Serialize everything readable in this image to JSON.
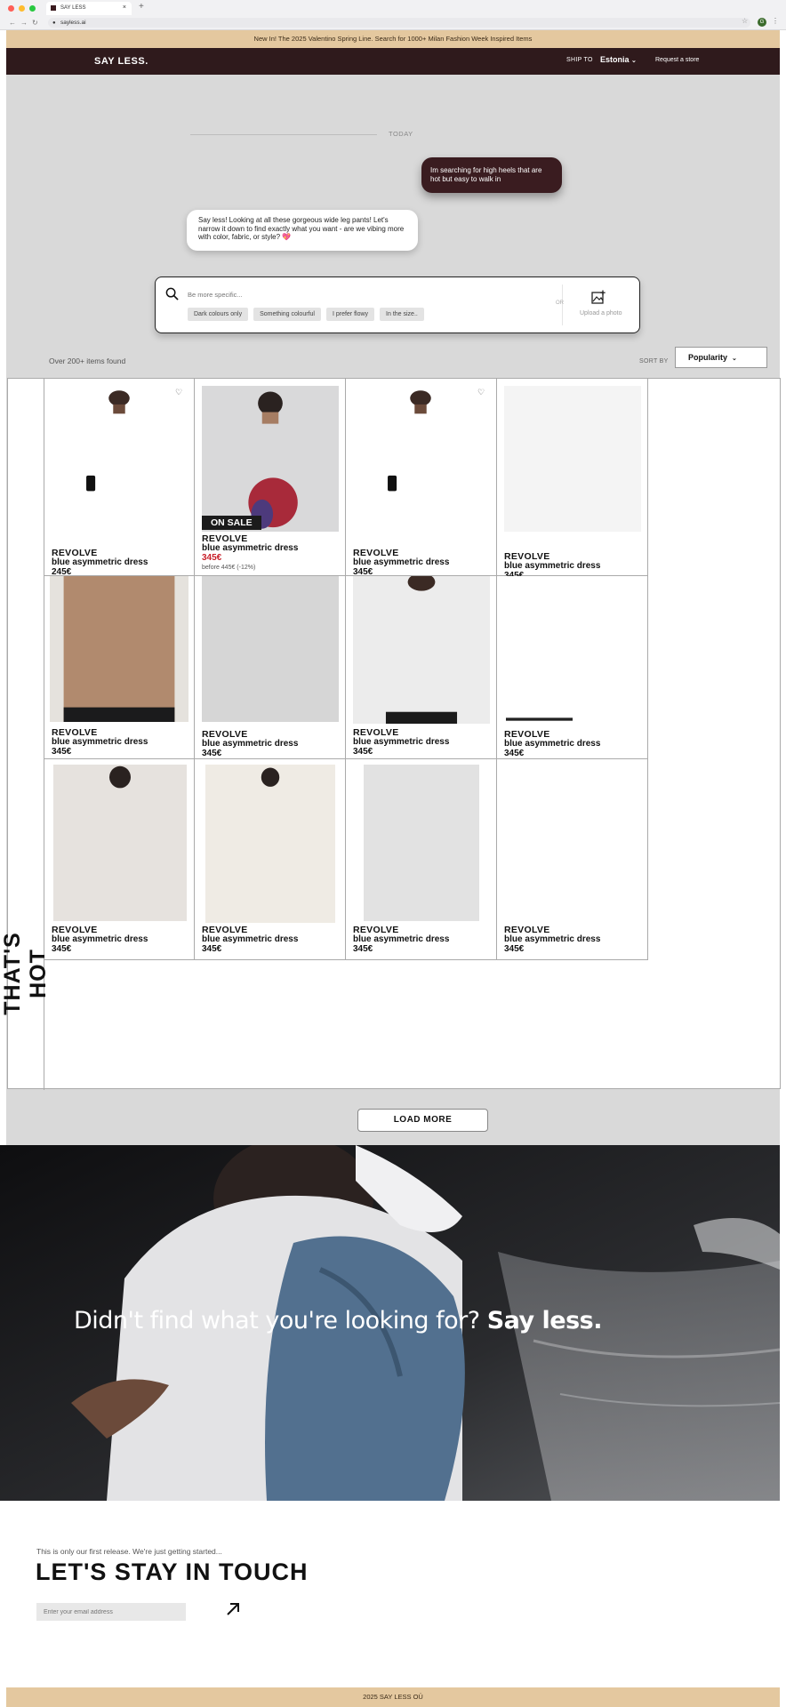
{
  "browser": {
    "tab_title": "SAY LESS",
    "url": "sayless.ai"
  },
  "promo_text": "New In! The 2025 Valentino Spring Line. Search for 1000+ Milan Fashion Week Inspired Items",
  "nav": {
    "logo": "SAY LESS.",
    "ship_to_label": "SHIP TO",
    "country": "Estonia",
    "request_store": "Request a store"
  },
  "chat": {
    "date_label": "TODAY",
    "user_message": "Im searching for high heels that are hot but easy to walk in",
    "bot_message": "Say less! Looking at all these gorgeous wide leg pants! Let's narrow it down to find exactly what you want - are we vibing more with color, fabric, or style? 💖"
  },
  "search": {
    "placeholder": "Be more specific...",
    "chips": [
      "Dark colours only",
      "Something colourful",
      "I prefer flowy",
      "In the size.."
    ],
    "or_label": "OR",
    "upload_label": "Upload a photo"
  },
  "results": {
    "count_text": "Over 200+ items found",
    "sort_label": "SORT BY",
    "sort_value": "Popularity"
  },
  "side_label": "THAT'S HOT",
  "products": [
    {
      "brand": "REVOLVE",
      "name": "blue asymmetric dress",
      "price": "245€",
      "sale": false,
      "was": "",
      "img": "navy-dress"
    },
    {
      "brand": "REVOLVE",
      "name": "blue asymmetric dress",
      "price": "345€",
      "sale": true,
      "was": "before 445€ (-12%)",
      "img": "strapless-floral",
      "badge": "ON SALE"
    },
    {
      "brand": "REVOLVE",
      "name": "blue asymmetric dress",
      "price": "345€",
      "sale": false,
      "was": "",
      "img": "navy-dress"
    },
    {
      "brand": "REVOLVE",
      "name": "blue asymmetric dress",
      "price": "345€",
      "sale": false,
      "was": "",
      "img": "cream-top"
    },
    {
      "brand": "REVOLVE",
      "name": "blue asymmetric dress",
      "price": "345€",
      "sale": false,
      "was": "",
      "img": "black-bra"
    },
    {
      "brand": "REVOLVE",
      "name": "blue asymmetric dress",
      "price": "345€",
      "sale": false,
      "was": "",
      "img": "bikini"
    },
    {
      "brand": "REVOLVE",
      "name": "blue asymmetric dress",
      "price": "345€",
      "sale": false,
      "was": "",
      "img": "white-shirt"
    },
    {
      "brand": "REVOLVE",
      "name": "blue asymmetric dress",
      "price": "345€",
      "sale": false,
      "was": "",
      "img": "black-jeans"
    },
    {
      "brand": "REVOLVE",
      "name": "blue asymmetric dress",
      "price": "345€",
      "sale": false,
      "was": "",
      "img": "burgundy-dress"
    },
    {
      "brand": "REVOLVE",
      "name": "blue asymmetric dress",
      "price": "345€",
      "sale": false,
      "was": "",
      "img": "black-gown"
    },
    {
      "brand": "REVOLVE",
      "name": "blue asymmetric dress",
      "price": "345€",
      "sale": false,
      "was": "",
      "img": "zebra-dress"
    },
    {
      "brand": "REVOLVE",
      "name": "blue asymmetric dress",
      "price": "345€",
      "sale": false,
      "was": "",
      "img": "camel-dress"
    }
  ],
  "load_more": "LOAD MORE",
  "hero": {
    "text_regular": "Didn't find what you're looking for?",
    "text_bold": "Say less."
  },
  "newsletter": {
    "subline": "This is only our first release. We're just getting started...",
    "heading": "LET'S STAY IN TOUCH",
    "email_placeholder": "Enter your email address"
  },
  "copyright": "2025 SAY LESS OÜ",
  "colors": {
    "brand_dark": "#2f1a1c",
    "promo_beige": "#e4c89f",
    "sale_red": "#c8202a"
  }
}
